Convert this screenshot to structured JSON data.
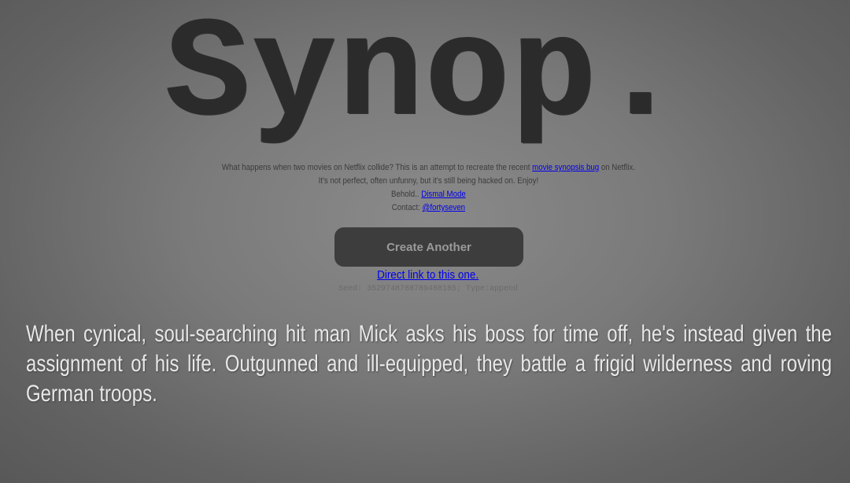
{
  "logo": {
    "text": "Synop."
  },
  "intro": {
    "line1_prefix": "What happens when two movies on Netflix collide? This is an attempt to recreate the recent ",
    "line1_link": "movie synopsis bug",
    "line1_suffix": " on Netflix.",
    "line2": "It's not perfect, often unfunny, but it's still being hacked on. Enjoy!",
    "line3_prefix": "Behold.. ",
    "line3_link": "Dismal Mode",
    "line4_prefix": "Contact: ",
    "line4_link": "@fortyseven"
  },
  "actions": {
    "create_another": "Create Another",
    "direct_link": "Direct link to this one."
  },
  "seed": {
    "text": "Seed: 3529748788789488185; Type:append"
  },
  "synopsis": {
    "text": "When cynical, soul-searching hit man Mick asks his boss for time off, he's instead given the assignment of his life. Outgunned and ill-equipped, they battle a frigid wilderness and roving German troops."
  }
}
